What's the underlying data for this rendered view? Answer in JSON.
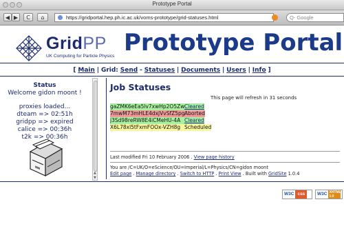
{
  "browser": {
    "window_title": "Prototype Portal",
    "url": "https://gridportal.hep.ph.ic.ac.uk/voms-prototype/grid-statuses.html",
    "search_placeholder": "Q- Google",
    "buttons": {
      "back": "◀",
      "forward": "▶",
      "reload": "C",
      "home": "⌂"
    }
  },
  "header": {
    "logo_grid": "Grid",
    "logo_pp": "PP",
    "logo_sub": "UK Computing for Particle Physics",
    "title": "Prototype Portal"
  },
  "nav": {
    "open": "[",
    "main": "Main",
    "sep1": "|",
    "grid": "Grid",
    "colon": ":",
    "send": "Send",
    "dash": "-",
    "statuses": "Statuses",
    "sep2": "|",
    "documents": "Documents",
    "sep3": "|",
    "users": "Users",
    "sep4": "|",
    "info": "Info",
    "close": "]"
  },
  "side": {
    "heading": "Status",
    "welcome": "Welcome gidon moont !",
    "proxies_loaded": "proxies loaded...",
    "proxies": [
      "dteam => 02:51h",
      "gridpp => expired",
      "calice => 00:36h",
      "t2k => 00:36h"
    ]
  },
  "main": {
    "heading": "Job Statuses",
    "refresh_text": "This page will refresh in 31 seconds",
    "jobs": [
      {
        "id": "gaZMK6eEa5lv7xwHp2O5Zw",
        "status": "Cleared",
        "color": "#a8f0a0",
        "link": true
      },
      {
        "id": "7mwM73mHLE4dxjVvSfZ5pg",
        "status": "Aborted",
        "color": "#f09a9a",
        "link": false
      },
      {
        "id": "j3Sd98reRW8E4iCMeHU-4A",
        "status": "Cleared",
        "color": "#a8f0a0",
        "link": true
      },
      {
        "id": "X6L78xl5tFxmFOOx-VZH8g",
        "status": "Scheduled",
        "color": "#f7f7a0",
        "link": false
      }
    ],
    "last_modified": "Last modified Fri 10 February 2006 .",
    "view_history": "View page history",
    "you_are": "You are /C=UK/O=eScience/OU=Imperial/L=Physics/CN=gidon moont",
    "edit_page": "Edit page",
    "dot1": ".",
    "manage_dir": "Manage directory",
    "dot2": ".",
    "switch_http": "Switch to HTTP",
    "dot3": ".",
    "print_view": "Print View",
    "built_with": ". Built with",
    "gridsite": "GridSite",
    "version": "1.0.4"
  },
  "badges": {
    "css": {
      "w3c": "W3C",
      "label": "css",
      "color": "#e05a2a"
    },
    "xhtml": {
      "w3c": "W3C",
      "label": "XHTML 1.0",
      "color": "#e08a1a"
    }
  }
}
